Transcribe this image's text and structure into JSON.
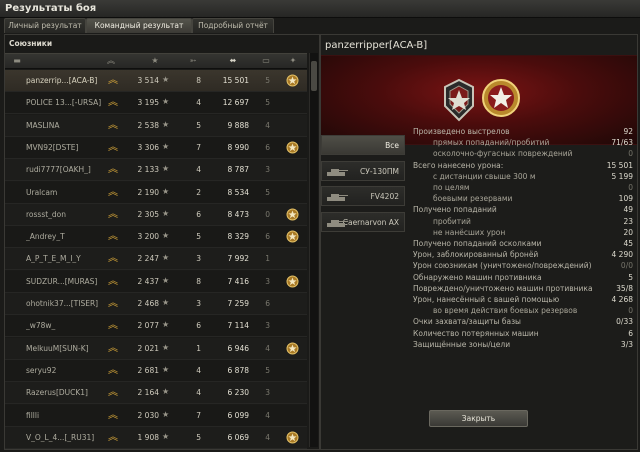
{
  "window": {
    "title": "Результаты боя"
  },
  "tabs": [
    {
      "label": "Личный результат"
    },
    {
      "label": "Командный результат"
    },
    {
      "label": "Подробный отчёт"
    }
  ],
  "team": {
    "label": "Союзники"
  },
  "rows": [
    {
      "name": "panzerrip...[ACA-B]",
      "xp": "3 514",
      "frags": "8",
      "damage": "15 501",
      "kills": "5",
      "medal": true,
      "self": true
    },
    {
      "name": "POLICE 13...[-URSA]",
      "xp": "3 195",
      "frags": "4",
      "damage": "12 697",
      "kills": "5",
      "medal": false
    },
    {
      "name": "MASLINA",
      "xp": "2 538",
      "frags": "5",
      "damage": "9 888",
      "kills": "4",
      "medal": false
    },
    {
      "name": "MVN92[DSTE]",
      "xp": "3 306",
      "frags": "7",
      "damage": "8 990",
      "kills": "6",
      "medal": true
    },
    {
      "name": "rudi7777[OAKH_]",
      "xp": "2 133",
      "frags": "4",
      "damage": "8 787",
      "kills": "3",
      "medal": false
    },
    {
      "name": "Uralcam",
      "xp": "2 190",
      "frags": "2",
      "damage": "8 534",
      "kills": "5",
      "medal": false
    },
    {
      "name": "rossst_don",
      "xp": "2 305",
      "frags": "6",
      "damage": "8 473",
      "kills": "0",
      "medal": true
    },
    {
      "name": "_Andrey_T",
      "xp": "3 200",
      "frags": "5",
      "damage": "8 329",
      "kills": "6",
      "medal": true
    },
    {
      "name": "A_P_T_E_M_I_Y",
      "xp": "2 247",
      "frags": "3",
      "damage": "7 992",
      "kills": "1",
      "medal": false
    },
    {
      "name": "SUDZUR...[MURAS]",
      "xp": "2 437",
      "frags": "8",
      "damage": "7 416",
      "kills": "3",
      "medal": true
    },
    {
      "name": "ohotnik37...[TISER]",
      "xp": "2 468",
      "frags": "3",
      "damage": "7 259",
      "kills": "6",
      "medal": false
    },
    {
      "name": "_w78w_",
      "xp": "2 077",
      "frags": "6",
      "damage": "7 114",
      "kills": "3",
      "medal": false
    },
    {
      "name": "MelkuuM[SUN-K]",
      "xp": "2 021",
      "frags": "1",
      "damage": "6 946",
      "kills": "4",
      "medal": true
    },
    {
      "name": "seryu92",
      "xp": "2 681",
      "frags": "4",
      "damage": "6 878",
      "kills": "5",
      "medal": false
    },
    {
      "name": "Razerus[DUCK1]",
      "xp": "2 164",
      "frags": "4",
      "damage": "6 230",
      "kills": "3",
      "medal": false
    },
    {
      "name": "fillli",
      "xp": "2 030",
      "frags": "7",
      "damage": "6 099",
      "kills": "4",
      "medal": false
    },
    {
      "name": "V_O_L_4...[_RU31]",
      "xp": "1 908",
      "frags": "5",
      "damage": "6 069",
      "kills": "4",
      "medal": true
    }
  ],
  "detail": {
    "player": "panzerripper[ACA-B]",
    "vehicle_tabs": [
      {
        "label": "Все"
      },
      {
        "label": "СУ-130ПМ"
      },
      {
        "label": "FV4202"
      },
      {
        "label": "Caernarvon AX"
      }
    ],
    "stats": [
      {
        "label": "Произведено выстрелов",
        "value": "92",
        "sub": false
      },
      {
        "label": "прямых попаданий/пробитий",
        "value": "71/63",
        "sub": true
      },
      {
        "label": "осколочно-фугасных повреждений",
        "value": "0",
        "sub": true,
        "dim": true
      },
      {
        "label": "Всего нанесено урона:",
        "value": "15 501",
        "sub": false
      },
      {
        "label": "с дистанции свыше 300 м",
        "value": "5 199",
        "sub": true
      },
      {
        "label": "по целям",
        "value": "0",
        "sub": true,
        "dim": true
      },
      {
        "label": "боевыми резервами",
        "value": "109",
        "sub": true
      },
      {
        "label": "Получено попаданий",
        "value": "49",
        "sub": false
      },
      {
        "label": "пробитий",
        "value": "23",
        "sub": true
      },
      {
        "label": "не нанёсших урон",
        "value": "20",
        "sub": true
      },
      {
        "label": "Получено попаданий осколками",
        "value": "45",
        "sub": false
      },
      {
        "label": "Урон, заблокированный бронёй",
        "value": "4 290",
        "sub": false
      },
      {
        "label": "Урон союзникам (уничтожено/повреждений)",
        "value": "0/0",
        "sub": false,
        "dim": true
      },
      {
        "label": "Обнаружено машин противника",
        "value": "5",
        "sub": false
      },
      {
        "label": "Повреждено/уничтожено машин противника",
        "value": "35/8",
        "sub": false
      },
      {
        "label": "Урон, нанесённый с вашей помощью",
        "value": "4 268",
        "sub": false
      },
      {
        "label": "во время действия боевых резервов",
        "value": "0",
        "sub": true,
        "dim": true
      },
      {
        "label": "Очки захвата/защиты базы",
        "value": "0/33",
        "sub": false
      },
      {
        "label": "Количество потерянных машин",
        "value": "6",
        "sub": false
      },
      {
        "label": "Защищённые зоны/цели",
        "value": "3/3",
        "sub": false
      }
    ],
    "close_label": "Закрыть"
  },
  "icons": {
    "vehicle_class": "tank-type-icon",
    "rank": "chevron-rank-icon",
    "star": "star-icon",
    "damage": "shell-icon",
    "kills": "tank-kill-icon",
    "medal": "medal-icon"
  },
  "colors": {
    "accent": "#d7a73a",
    "banner": "#6a1010"
  }
}
